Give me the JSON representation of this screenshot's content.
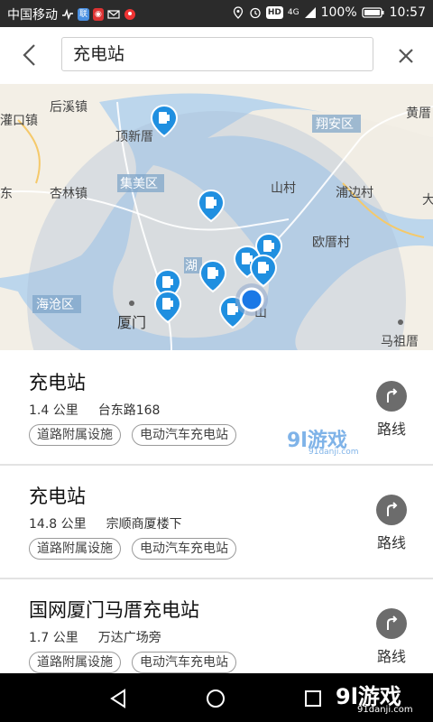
{
  "status_bar": {
    "carrier": "中国移动",
    "battery": "100%",
    "time": "10:57",
    "hd": "HD",
    "signal": "4G"
  },
  "header": {
    "search_value": "充电站"
  },
  "map": {
    "labels": {
      "houxi": "后溪镇",
      "guankou": "灌口镇",
      "dingxincuo": "顶新厝",
      "jimei": "集美区",
      "xinglin": "杏林镇",
      "haicang": "海沧区",
      "xiamen": "厦门",
      "xiangan": "翔安区",
      "huangcuo": "黄厝",
      "shancun": "山村",
      "pubiancun": "浦边村",
      "ouconcun": "欧厝村",
      "mazucuo": "马祖厝",
      "hu": "湖",
      "shan": "山",
      "dong": "东",
      "da": "大"
    },
    "marker_icon": "charging-station-pin-icon",
    "location_icon": "current-location-icon",
    "water_color": "#bcd6ec",
    "land_color": "#f3efe6",
    "overlay_color": "#c5d2e2",
    "marker_color": "#1f8fe0"
  },
  "results": [
    {
      "title": "充电站",
      "distance": "1.4 公里",
      "address": "台东路168",
      "tags": [
        "道路附属设施",
        "电动汽车充电站"
      ],
      "route_label": "路线"
    },
    {
      "title": "充电站",
      "distance": "14.8 公里",
      "address": "宗顺商厦楼下",
      "tags": [
        "道路附属设施",
        "电动汽车充电站"
      ],
      "route_label": "路线"
    },
    {
      "title": "国网厦门马厝充电站",
      "distance": "1.7 公里",
      "address": "万达广场旁",
      "tags": [
        "道路附属设施",
        "电动汽车充电站"
      ],
      "route_label": "路线"
    }
  ],
  "watermark": {
    "logo": "9l游戏",
    "site": "91danji.com"
  },
  "nav": {
    "back_icon": "nav-back-icon",
    "home_icon": "nav-home-icon",
    "recent_icon": "nav-recent-icon"
  }
}
